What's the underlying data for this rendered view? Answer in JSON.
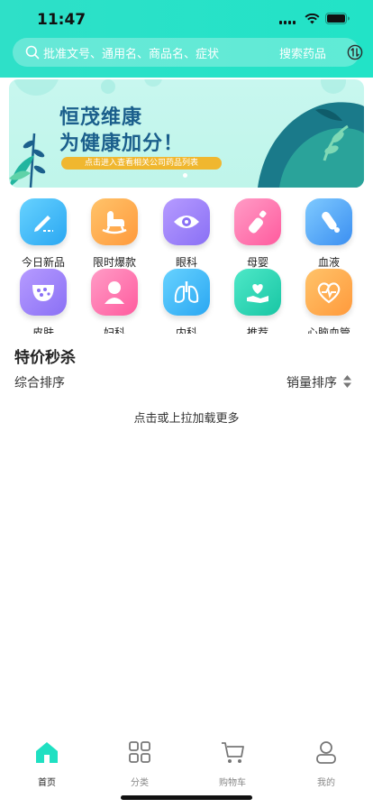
{
  "status_bar": {
    "time": "11:47"
  },
  "search": {
    "placeholder": "批准文号、通用名、商品名、症状",
    "button": "搜索药品",
    "icons": [
      "search-icon",
      "scan-icon"
    ]
  },
  "banner": {
    "line1": "恒茂维康",
    "line2": "为健康加分！",
    "cta": "点击进入查看相关公司药品列表"
  },
  "categories": [
    {
      "label": "今日新品",
      "icon": "pen-icon",
      "color_a": "#67d2ff",
      "color_b": "#2aa7f2"
    },
    {
      "label": "限时爆款",
      "icon": "rocking-horse-icon",
      "color_a": "#ffc36a",
      "color_b": "#ff9a3c"
    },
    {
      "label": "眼科",
      "icon": "eye-icon",
      "color_a": "#b69bff",
      "color_b": "#8a70f5"
    },
    {
      "label": "母婴",
      "icon": "baby-bottle-icon",
      "color_a": "#ff9cc6",
      "color_b": "#ff5b9e"
    },
    {
      "label": "血液",
      "icon": "test-tube-icon",
      "color_a": "#7fcaff",
      "color_b": "#3b8ff1"
    },
    {
      "label": "皮肤",
      "icon": "skin-icon",
      "color_a": "#b69bff",
      "color_b": "#8a70f5"
    },
    {
      "label": "妇科",
      "icon": "woman-icon",
      "color_a": "#ff9cc6",
      "color_b": "#ff5b9e"
    },
    {
      "label": "内科",
      "icon": "lungs-icon",
      "color_a": "#67d2ff",
      "color_b": "#2aa7f2"
    },
    {
      "label": "推荐",
      "icon": "heart-hand-icon",
      "color_a": "#4ee8c8",
      "color_b": "#18c6a4"
    },
    {
      "label": "心脑血管",
      "icon": "heart-pulse-icon",
      "color_a": "#ffc36a",
      "color_b": "#ff9a3c"
    }
  ],
  "flash_sale": {
    "title": "特价秒杀",
    "sort_default": "综合排序",
    "sort_sales": "销量排序",
    "load_more": "点击或上拉加载更多"
  },
  "tabs": [
    {
      "label": "首页",
      "icon": "home-icon",
      "active": true
    },
    {
      "label": "分类",
      "icon": "grid-icon",
      "active": false
    },
    {
      "label": "购物车",
      "icon": "cart-icon",
      "active": false
    },
    {
      "label": "我的",
      "icon": "profile-icon",
      "active": false
    }
  ],
  "colors": {
    "accent": "#22e3c7",
    "banner_text": "#1b5f8c",
    "cta": "#f0b72f"
  }
}
